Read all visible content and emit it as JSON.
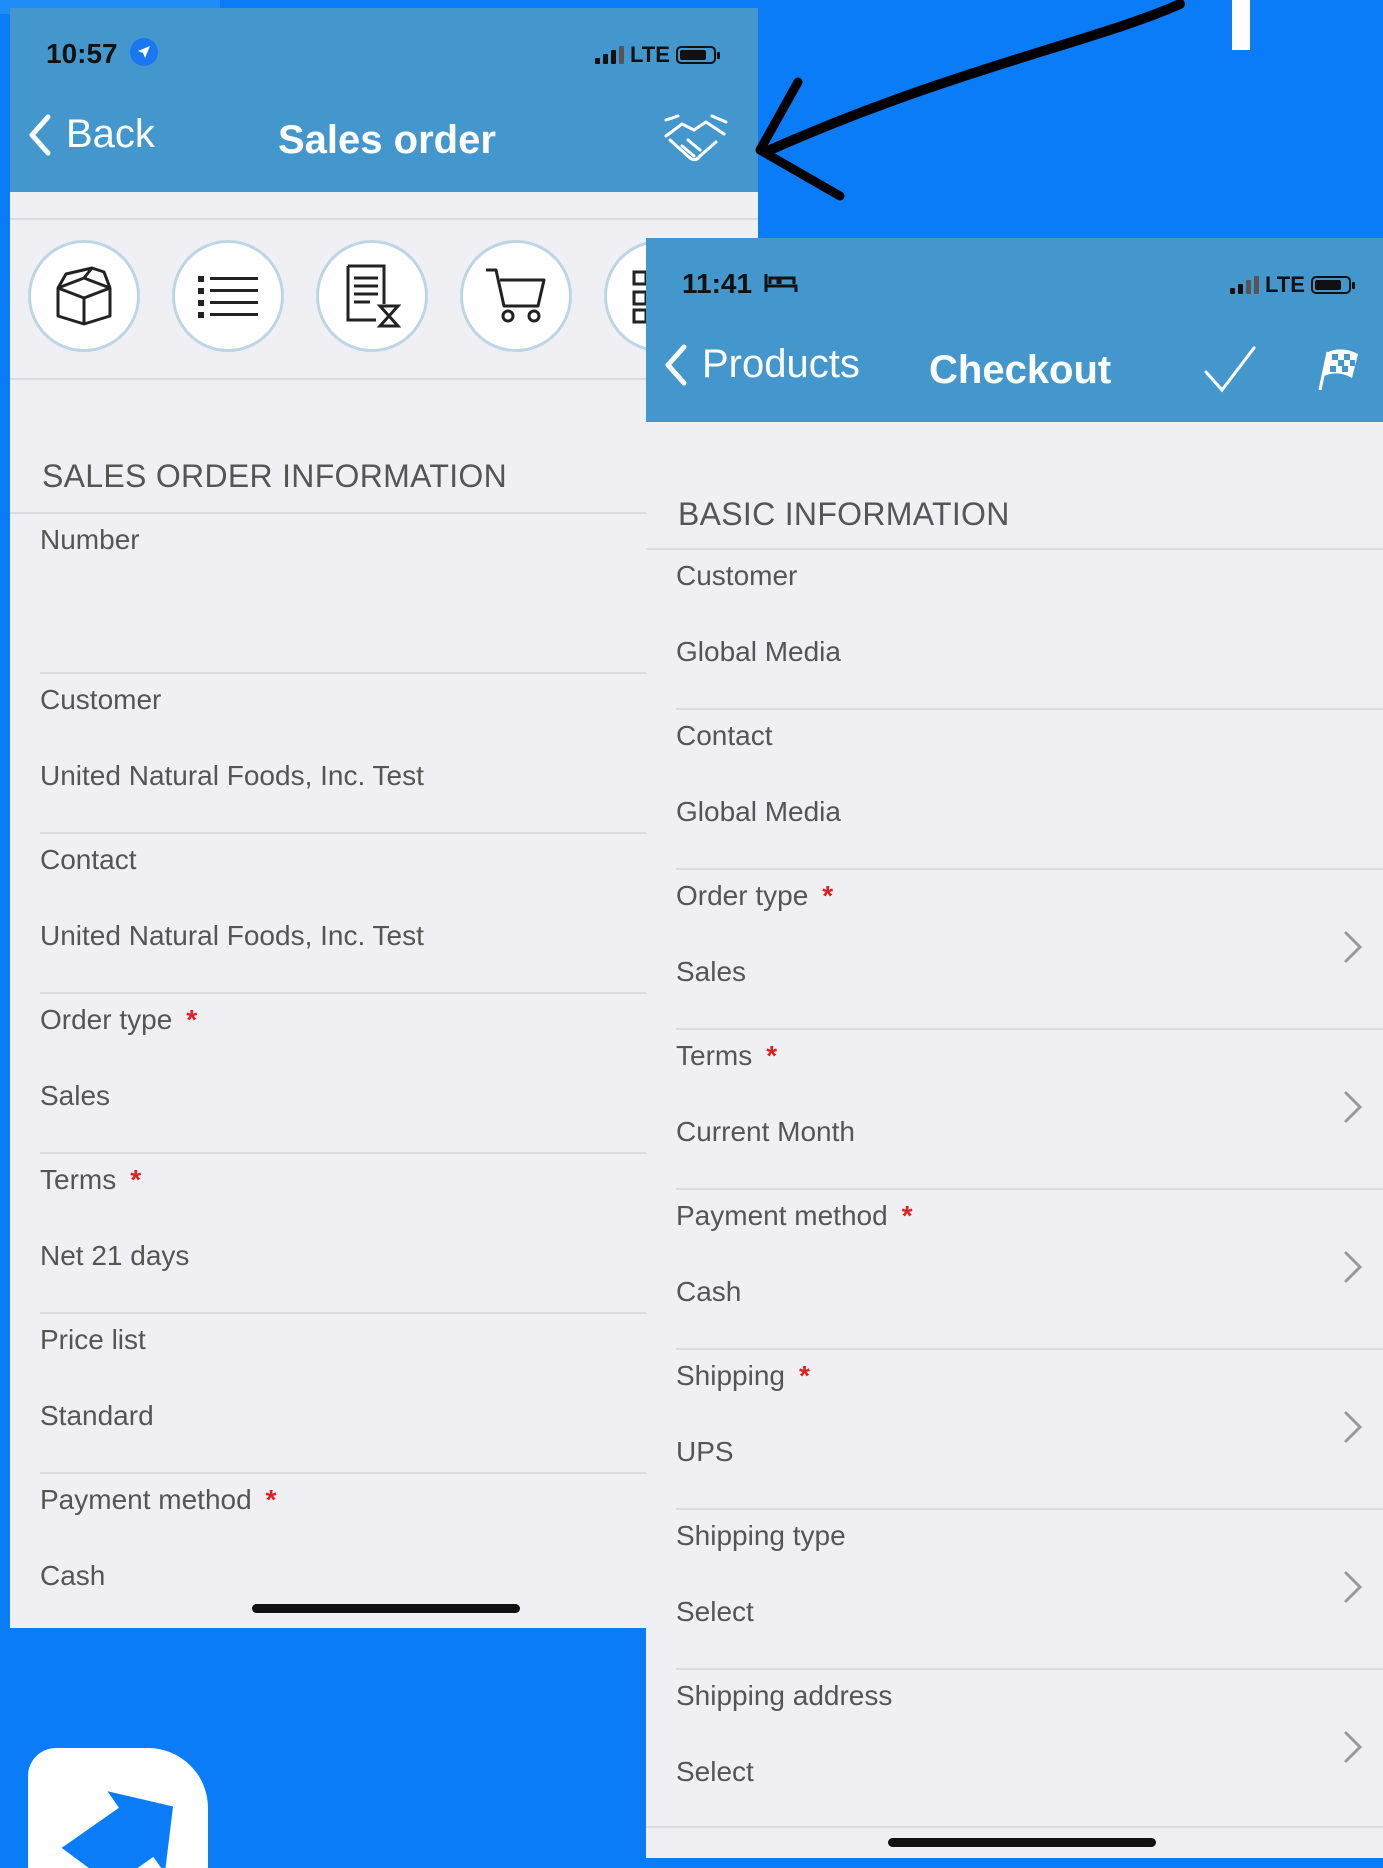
{
  "left_screen": {
    "status": {
      "time": "10:57",
      "network": "LTE"
    },
    "nav": {
      "back_label": "Back",
      "title": "Sales order"
    },
    "toolbar_icons": [
      "box-open-icon",
      "list-icon",
      "document-hourglass-icon",
      "cart-icon",
      "checklist-icon"
    ],
    "section_title": "SALES ORDER INFORMATION",
    "fields": [
      {
        "label": "Number",
        "value": "",
        "required": ""
      },
      {
        "label": "Customer",
        "value": "United Natural Foods, Inc. Test",
        "required": ""
      },
      {
        "label": "Contact",
        "value": "United Natural Foods, Inc. Test",
        "required": ""
      },
      {
        "label": "Order type",
        "value": "Sales",
        "required": "*"
      },
      {
        "label": "Terms",
        "value": "Net 21 days",
        "required": "*"
      },
      {
        "label": "Price list",
        "value": "Standard",
        "required": ""
      },
      {
        "label": "Payment method",
        "value": "Cash",
        "required": "*"
      }
    ]
  },
  "right_screen": {
    "status": {
      "time": "11:41",
      "network": "LTE"
    },
    "nav": {
      "back_label": "Products",
      "title": "Checkout"
    },
    "section_title": "BASIC INFORMATION",
    "fields": [
      {
        "label": "Customer",
        "value": "Global Media",
        "required": ""
      },
      {
        "label": "Contact",
        "value": "Global Media",
        "required": ""
      },
      {
        "label": "Order type",
        "value": "Sales",
        "required": "*"
      },
      {
        "label": "Terms",
        "value": "Current Month",
        "required": "*"
      },
      {
        "label": "Payment method",
        "value": "Cash",
        "required": "*"
      },
      {
        "label": "Shipping",
        "value": "UPS",
        "required": "*"
      },
      {
        "label": "Shipping type",
        "value": "Select",
        "required": ""
      },
      {
        "label": "Shipping address",
        "value": "Select",
        "required": ""
      }
    ]
  },
  "colors": {
    "nav_bar": "#4497cc",
    "background": "#0a7cf7",
    "required": "#e02020",
    "panel": "#f0eff4"
  }
}
